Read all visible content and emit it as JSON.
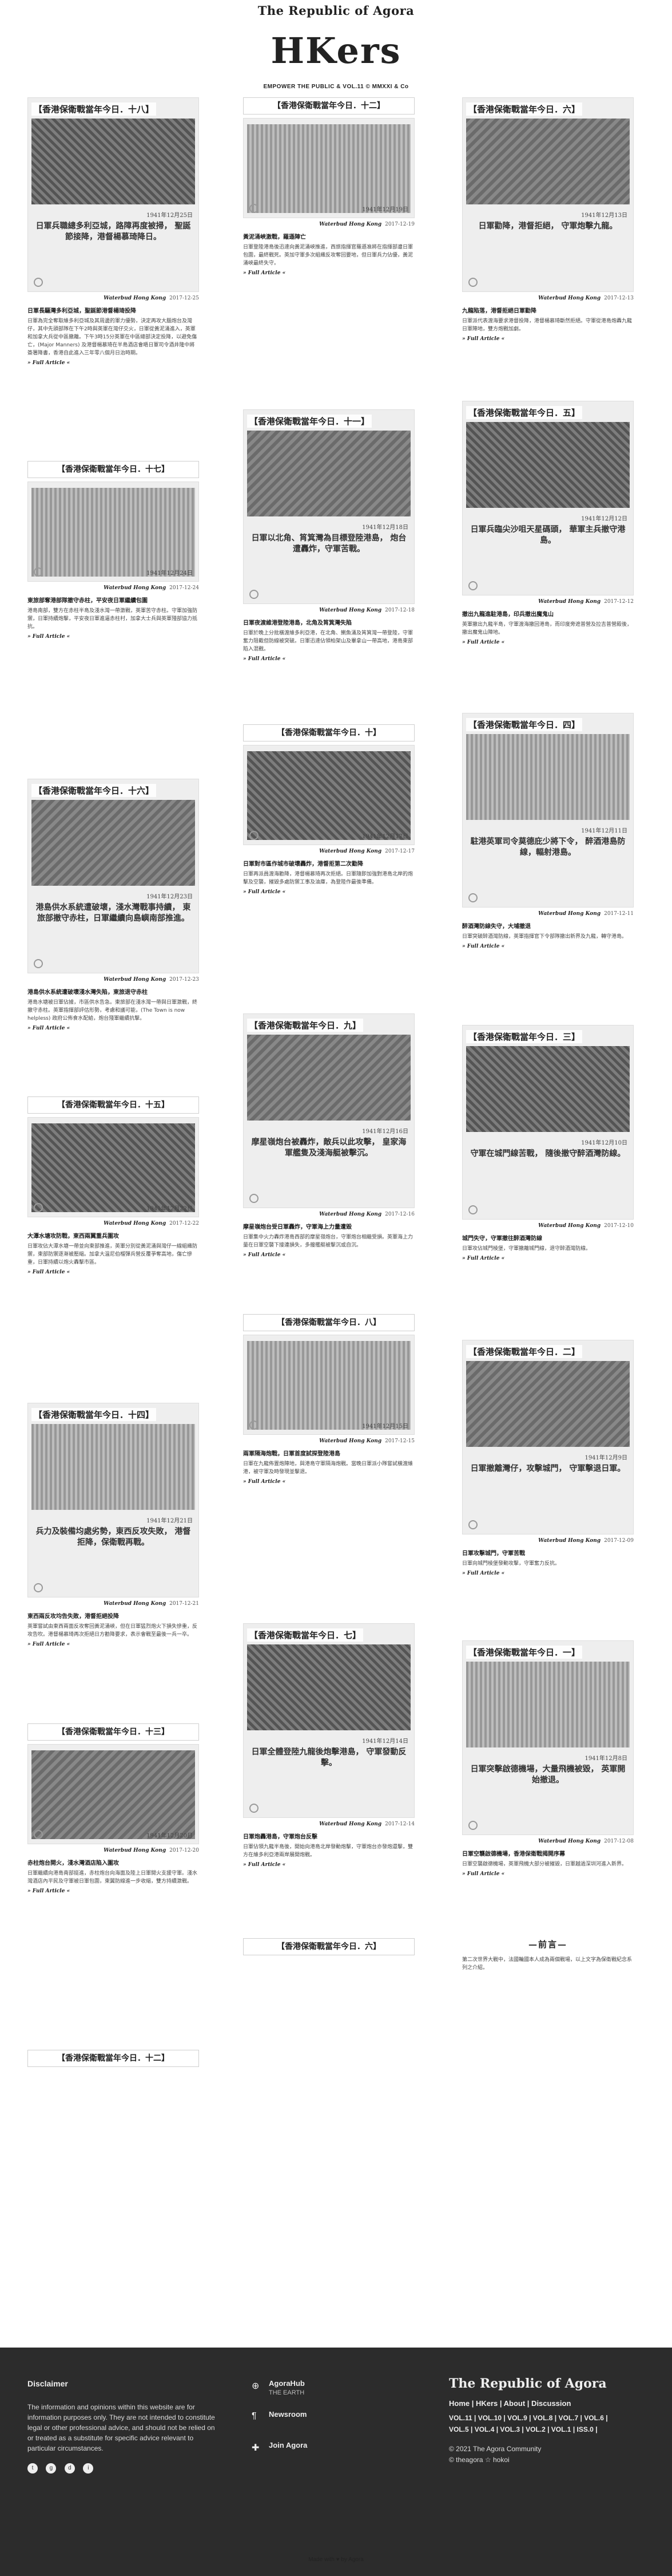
{
  "site": {
    "brand": "The Republic of Agora",
    "logo": "HKers",
    "tagline": "EMPOWER THE PUBLIC & VOL.11 © MMXXI & Co"
  },
  "columns": [
    {
      "items": [
        {
          "kind": "card",
          "title": "【香港保衛戰當年今日．十八】",
          "date_stamp": "1941年12月25日",
          "caption": "日軍兵職總多利亞城，路障再度被掃，\n聖誕節接降，港督楊慕琦降日。",
          "source": "Waterbud Hong Kong",
          "date": "2017-12-25",
          "headline": "日軍長驅灣多利亞城，聖誕節港督楊琦投降",
          "excerpt": "日軍為完全奪取維多利亞城及其周邊的軍力優勢，決定再攻大腦炮台及灣仔，其中先頭部隊在下午2時與英軍在灣仔交火，日軍從黃泥涌進入，英軍和加拿大兵從中區撤離。下午3時15分英軍在中區總部決定投降，以避免傷亡，(Major Manners) 及港督楊慕琦在半島酒店會晤日軍司令酒井隆中將簽署降書，香港自此進入三年零八個月日治時期。",
          "full": "» Full Article «"
        },
        {
          "kind": "card",
          "title": "【香港保衛戰當年今日．十七】",
          "date_stamp": "1941年12月24日",
          "caption": "東旅部兵力，屯軍，香港陷敵部隊守赤柱，\n平安夜，日軍繼續包圍赤柱。",
          "source": "Waterbud Hong Kong",
          "date": "2017-12-24",
          "headline": "東旅部奪港部隊撤守赤柱，平安夜日軍繼續包圍",
          "excerpt": "港島南部，雙方在赤柱半島及淺水灣一帶激戰，英軍苦守赤柱。守軍加強防禦，日軍持續炮擊，平安夜日軍進逼赤柱村，加拿大士兵與英軍殘部協力抵抗。",
          "full": "» Full Article «"
        },
        {
          "kind": "card",
          "title": "【香港保衛戰當年今日．十六】",
          "date_stamp": "1941年12月23日",
          "caption": "港島供水系統遭破壞，淺水灣戰事持續，\n東旅部撤守赤柱，日軍繼續向島嶼南部推進。",
          "source": "Waterbud Hong Kong",
          "date": "2017-12-23",
          "headline": "港島供水系統遭破壞淺水灣失陷，東旅退守赤柱",
          "excerpt": "港島水塘被日軍佔據，市區供水告急。東旅部在淺水灣一帶與日軍激戰，終撤守赤柱。英軍指揮部評估形勢，考慮和議可能，(The Town is now helpless) 政府公佈食水配給，炮台殘軍繼續抗擊。",
          "full": "» Full Article «"
        },
        {
          "kind": "card",
          "title": "【香港保衛戰當年今日．十五】",
          "date_stamp": "1941年12月22日",
          "caption": "大潭水塘所要人物被圍，灣仔總部多處被轟炸，\n反攻聖誕，東西兩翼重兵合圍。",
          "source": "Waterbud Hong Kong",
          "date": "2017-12-22",
          "headline": "大潭水塘攻防戰，東西兩翼重兵圍攻",
          "excerpt": "日軍攻佔大潭水塘一帶並向東部推進，英軍分別從黃泥涌與灣仔一線組織防禦，東部防禦逐漸被壓縮。加拿大溫尼伯榴彈兵營反覆爭奪高地，傷亡慘重，日軍持續以炮火轟擊市區。",
          "full": "» Full Article «"
        },
        {
          "kind": "card",
          "title": "【香港保衛戰當年今日．十四】",
          "date_stamp": "1941年12月21日",
          "caption": "兵力及裝備均處劣勢，東西反攻失敗，\n港督拒降，保衛戰再戰。",
          "source": "Waterbud Hong Kong",
          "date": "2017-12-21",
          "headline": "東西兩反攻均告失敗，港督拒絕投降",
          "excerpt": "英軍嘗試由東西兩面反攻奪回黃泥涌峽，但在日軍猛烈炮火下損失慘重，反攻告吹。港督楊慕琦再次拒絕日方勸降要求，表示會戰至最後一兵一卒。",
          "full": "» Full Article «"
        },
        {
          "kind": "card",
          "title": "【香港保衛戰當年今日．十三】",
          "date_stamp": "1941年12月20日",
          "caption": "赤柱炮台向海上日軍開火，\n淺水灣酒店被包圍，東翼防線瓦解。",
          "source": "Waterbud Hong Kong",
          "date": "2017-12-20",
          "headline": "赤柱炮台開火，淺水灣酒店陷入圍攻",
          "excerpt": "日軍繼續向港島南部挺進，赤柱炮台向海面及陸上日軍開火支援守軍。淺水灣酒店內平民及守軍被日軍包圍，東翼防線進一步收縮，雙方持續激戰。",
          "full": "» Full Article «"
        },
        {
          "kind": "banner",
          "title": "【香港保衛戰當年今日．十二】"
        }
      ]
    },
    {
      "items": [
        {
          "kind": "card",
          "title": "【香港保衛戰當年今日．十二】",
          "date_stamp": "1941年12月19日",
          "caption": "日軍由黃泥涌峽推進，守軍撤往淺水灣，\n嘗試反攻，慘烈激戰。",
          "source": "Waterbud Hong Kong",
          "date": "2017-12-19",
          "headline": "黃泥涌峽激戰，羅遜陣亡",
          "excerpt": "日軍登陸港島後迅速向黃泥涌峽推進，西旅指揮官羅遜准將在指揮部遭日軍包圍，最終戰死。英加守軍多次組織反攻奪回要地，但日軍兵力佔優，黃泥涌峽最終失守。",
          "full": "» Full Article «"
        },
        {
          "kind": "card",
          "title": "【香港保衛戰當年今日．十一】",
          "date_stamp": "1941年12月18日",
          "caption": "日軍以北角、筲箕灣為目標登陸港島，\n炮台遭轟炸，守軍苦戰。",
          "source": "Waterbud Hong Kong",
          "date": "2017-12-18",
          "headline": "日軍夜渡維港登陸港島，北角及筲箕灣失陷",
          "excerpt": "日軍於晚上分批橫渡維多利亞港，在北角、鰂魚涌及筲箕灣一帶登陸，守軍奮力阻截但防線被突破。日軍迅速佔領柏架山及畢拿山一帶高地，港島東部陷入混戰。",
          "full": "» Full Article «"
        },
        {
          "kind": "card",
          "title": "【香港保衛戰當年今日．十】",
          "date_stamp": "1941年12月17日",
          "caption": "日軍對市區作城市破壞轟炸，兩度勸降，\n港督拒絕，登陸準備就緒。",
          "source": "Waterbud Hong Kong",
          "date": "2017-12-17",
          "headline": "日軍對市區作城市破壞轟炸，港督拒第二次勸降",
          "excerpt": "日軍再派員渡海勸降，港督楊慕琦再次拒絕。日軍隨即加強對港島北岸的炮擊及空襲，摧毀多處防禦工事及油庫，為登陸作最後準備。",
          "full": "» Full Article «"
        },
        {
          "kind": "card",
          "title": "【香港保衛戰當年今日．九】",
          "date_stamp": "1941年12月16日",
          "caption": "摩星嶺炮台被轟炸，敵兵以此攻擊，\n皇家海軍艦隻及淺海艇被擊沉。",
          "source": "Waterbud Hong Kong",
          "date": "2017-12-16",
          "headline": "摩星嶺炮台受日軍轟炸，守軍海上力量遭毀",
          "excerpt": "日軍集中火力轟炸港島西部的摩星嶺炮台，守軍炮台相繼受損。英軍海上力量在日軍空襲下接連損失，多艘艦艇被擊沉或自沉。",
          "full": "» Full Article «"
        },
        {
          "kind": "card",
          "title": "【香港保衛戰當年今日．八】",
          "date_stamp": "1941年12月15日",
          "caption": "兩軍隔海炮戰，日軍嘗試登陸港島，\n被守軍擊退。",
          "source": "Waterbud Hong Kong",
          "date": "2017-12-15",
          "headline": "兩軍隔海炮戰，日軍首度試探登陸港島",
          "excerpt": "日軍在九龍佈置炮陣地，與港島守軍隔海炮戰。當晚日軍派小隊嘗試橫渡維港，被守軍及時發現並擊退。",
          "full": "» Full Article «"
        },
        {
          "kind": "card",
          "title": "【香港保衛戰當年今日．七】",
          "date_stamp": "1941年12月14日",
          "caption": "日軍全體登陸九龍後炮擊港島，\n守軍發動反擊。",
          "source": "Waterbud Hong Kong",
          "date": "2017-12-14",
          "headline": "日軍炮轟港島，守軍炮台反擊",
          "excerpt": "日軍佔領九龍半島後，開始向港島北岸發動炮擊，守軍炮台亦發炮還擊，雙方在維多利亞港兩岸展開炮戰。",
          "full": "» Full Article «"
        },
        {
          "kind": "banner",
          "title": "【香港保衛戰當年今日．六】"
        }
      ]
    },
    {
      "items": [
        {
          "kind": "card",
          "title": "【香港保衛戰當年今日．六】",
          "date_stamp": "1941年12月13日",
          "caption": "日軍勸降，港督拒絕，\n守軍炮擊九龍。",
          "source": "Waterbud Hong Kong",
          "date": "2017-12-13",
          "headline": "九龍陷落，港督拒絕日軍勸降",
          "excerpt": "日軍派代表渡海要求港督投降，港督楊慕琦斷然拒絕。守軍從港島炮轟九龍日軍陣地，雙方炮戰加劇。",
          "full": "» Full Article «"
        },
        {
          "kind": "card",
          "title": "【香港保衛戰當年今日．五】",
          "date_stamp": "1941年12月12日",
          "caption": "日軍兵臨尖沙咀天星碼頭，\n華軍主兵撤守港島。",
          "source": "Waterbud Hong Kong",
          "date": "2017-12-12",
          "headline": "撤出九龍進駐港島，印兵撤出魔鬼山",
          "excerpt": "英軍撤出九龍半島，守軍渡海撤回港島，而印度旁遮普營及拉吉普營殿後，撤出魔鬼山陣地。",
          "full": "» Full Article «"
        },
        {
          "kind": "card",
          "title": "【香港保衛戰當年今日．四】",
          "date_stamp": "1941年12月11日",
          "caption": "駐港英軍司令莫德庇少將下令，\n醉酒港島防線，輻射港島。",
          "source": "Waterbud Hong Kong",
          "date": "2017-12-11",
          "headline": "醉酒灣防線失守，大埔撤退",
          "excerpt": "日軍突破醉酒灣防線，英軍指揮官下令部隊撤出新界及九龍，轉守港島。",
          "full": "» Full Article «"
        },
        {
          "kind": "card",
          "title": "【香港保衛戰當年今日．三】",
          "date_stamp": "1941年12月10日",
          "caption": "守軍在城門線苦戰，\n隨後撤守醉酒灣防線。",
          "source": "Waterbud Hong Kong",
          "date": "2017-12-10",
          "headline": "城門失守，守軍撤往醉酒灣防線",
          "excerpt": "日軍攻佔城門棱堡，守軍撤離城門線，退守醉酒灣防線。",
          "full": "» Full Article «"
        },
        {
          "kind": "card",
          "title": "【香港保衛戰當年今日．二】",
          "date_stamp": "1941年12月9日",
          "caption": "日軍撤離灣仔，攻擊城門，\n守軍擊退日軍。",
          "source": "Waterbud Hong Kong",
          "date": "2017-12-09",
          "headline": "日軍攻擊城門，守軍苦戰",
          "excerpt": "日軍向城門棱堡發動攻擊，守軍奮力反抗。",
          "full": "» Full Article «"
        },
        {
          "kind": "card",
          "title": "【香港保衛戰當年今日．一】",
          "date_stamp": "1941年12月8日",
          "caption": "日軍突擊啟德機場，大量飛機被毀，\n英軍開始撤退。",
          "source": "Waterbud Hong Kong",
          "date": "2017-12-08",
          "headline": "日軍空襲啟德機場，香港保衛戰揭開序幕",
          "excerpt": "日軍空襲啟德機場，英軍飛機大部分被摧毀，日軍越過深圳河進入新界。",
          "full": "» Full Article «"
        },
        {
          "kind": "preface",
          "title": "—前言—",
          "text": "第二次世界大戰中，法國輪國本人成為兩個戰場，以上文字為保衛戰紀念系列之介紹。"
        }
      ]
    }
  ],
  "footer": {
    "disclaimer_title": "Disclaimer",
    "disclaimer_text": "The information and opinions within this website are for information purposes only. They are not intended to constitute legal or other professional advice, and should not be relied on or treated as a substitute for specific advice relevant to particular circumstances.",
    "social": [
      "twitter-icon",
      "github-icon",
      "discord-icon",
      "instagram-icon"
    ],
    "nav": [
      {
        "icon": "globe-icon",
        "title": "AgoraHub",
        "sub": "THE EARTH"
      },
      {
        "icon": "paragraph-icon",
        "title": "Newsroom",
        "sub": ""
      },
      {
        "icon": "join-icon",
        "title": "Join Agora",
        "sub": ""
      }
    ],
    "republic_title": "The Republic of Agora",
    "links": "Home | HKers | About | Discussion",
    "vols_1": "VOL.11 | VOL.10 | VOL.9 | VOL.8 | VOL.7 | VOL.6 |",
    "vols_2": "VOL.5 | VOL.4 | VOL.3 | VOL.2 | VOL.1 | ISS.0 |",
    "copyright": "© 2021 The Agora Community",
    "handle": "© theagora ☆ hokoi"
  },
  "made_with": "Made with ♥ by Agora"
}
